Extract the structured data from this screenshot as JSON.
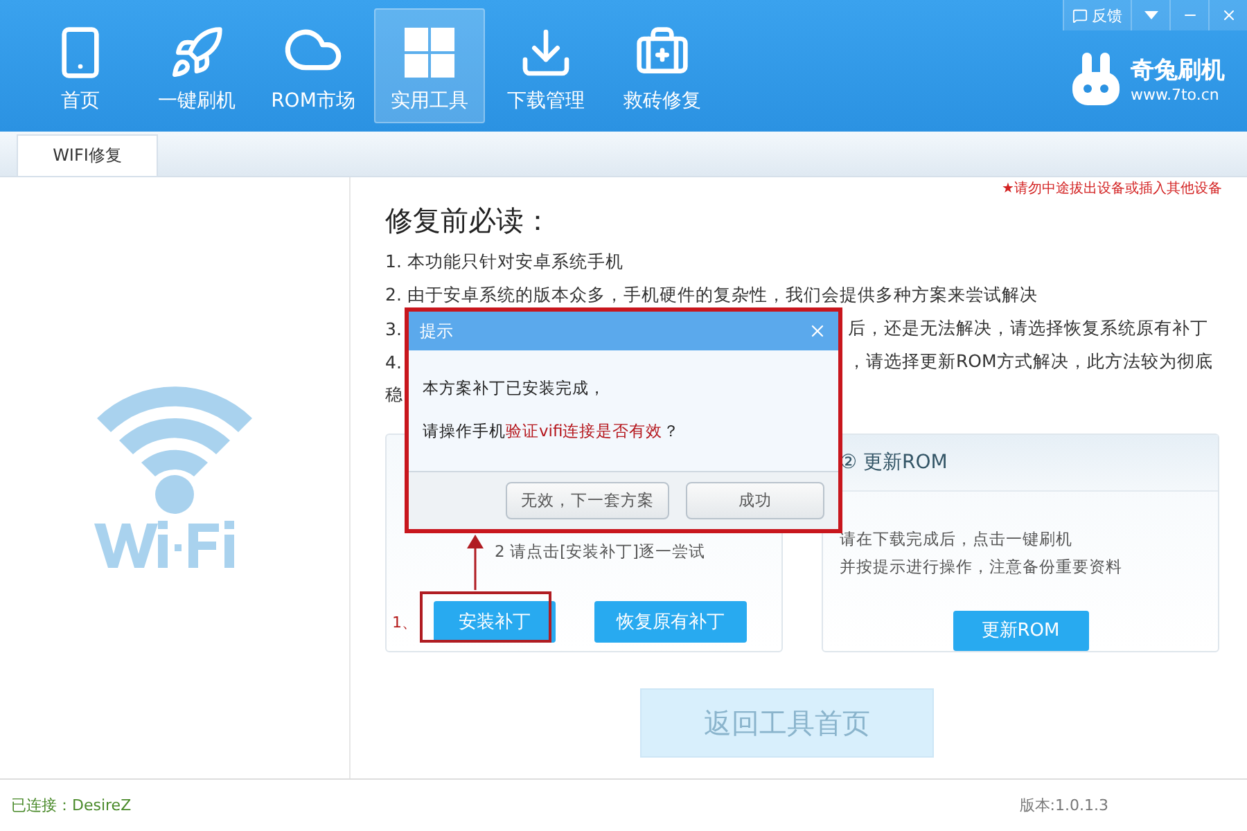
{
  "nav": [
    {
      "label": "首页",
      "selected": false
    },
    {
      "label": "一键刷机",
      "selected": false
    },
    {
      "label": "ROM市场",
      "selected": false
    },
    {
      "label": "实用工具",
      "selected": true
    },
    {
      "label": "下载管理",
      "selected": false
    },
    {
      "label": "救砖修复",
      "selected": false
    }
  ],
  "window_controls": {
    "feedback": "反馈"
  },
  "logo": {
    "name": "奇兔刷机",
    "url": "www.7to.cn"
  },
  "tabs": [
    {
      "label": "WIFI修复",
      "selected": true
    }
  ],
  "warning": "★请勿中途拔出设备或插入其他设备",
  "heading": "修复前必读：",
  "notes": [
    {
      "lead": "1. 本功能只针对安卓系统手机"
    },
    {
      "lead": "2. 由于安卓系统的版本众多，手机硬件的复杂性，我们会提供多种方案来尝试解决"
    },
    {
      "lead": "3.",
      "tail": "后，还是无法解决，请选择恢复系统原有补丁"
    },
    {
      "lead": "4.",
      "tail": "，请选择更新ROM方式解决，此方法较为彻底"
    },
    {
      "lead": "稳"
    }
  ],
  "patch_card": {
    "hint": "2 请点击[安装补丁]逐一尝试",
    "step": "1、",
    "buttons": [
      "安装补丁",
      "恢复原有补丁"
    ]
  },
  "rom_card": {
    "title": "② 更新ROM",
    "lines": [
      "请在下载完成后，点击一键刷机",
      "并按提示进行操作，注意备份重要资料"
    ],
    "button": "更新ROM"
  },
  "back_button": {
    "label": "返回工具首页",
    "disabled": true
  },
  "dialog": {
    "title": "提示",
    "messages": [
      [
        {
          "text": "本方案补丁已安装完成，",
          "kind": "plain"
        }
      ],
      [
        {
          "text": "请操作手机",
          "kind": "plain"
        },
        {
          "text": "验证vifi连接是否有效",
          "kind": "alert"
        },
        {
          "text": "？",
          "kind": "plain"
        }
      ]
    ],
    "buttons": [
      "无效，下一套方案",
      "成功"
    ]
  },
  "status_bar": {
    "connection": "已连接：DesireZ",
    "version": "版本:1.0.1.3"
  }
}
